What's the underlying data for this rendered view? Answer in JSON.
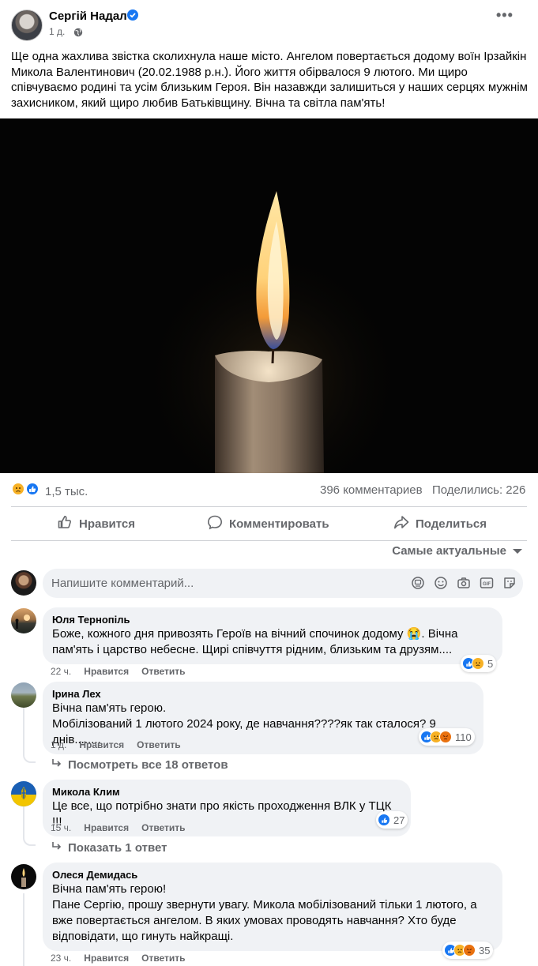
{
  "post": {
    "author": "Сергій Надал",
    "time": "1 д.",
    "more": "•••",
    "text": "Ще одна жахлива звістка сколихнула наше місто. Ангелом повертається додому воїн Ірзайкін Микола Валентинович (20.02.1988 р.н.). Його життя обірвалося 9 лютого. Ми щиро співчуваємо родині та усім близьким Героя. Він назавжди залишиться у наших серцях мужнім захисником, який щиро любив Батьківщину. Вічна та світла пам'ять!"
  },
  "stats": {
    "reactions": "1,5 тыс.",
    "comments": "396 комментариев",
    "shares": "Поделились: 226"
  },
  "actions": {
    "like": "Нравится",
    "comment": "Комментировать",
    "share": "Поделиться"
  },
  "sort": {
    "label": "Самые актуальные"
  },
  "composer": {
    "placeholder": "Напишите комментарий..."
  },
  "comments": [
    {
      "name": "Юля Тернопіль",
      "lines": [
        "Боже, кожного дня привозять Героїв на вічний спочинок додому 😭. Вічна",
        "пам'ять і царство небесне. Щирі співчуття рідним, близьким та друзям...."
      ],
      "time": "22 ч.",
      "like": "Нравится",
      "reply": "Ответить",
      "reactions": "5"
    },
    {
      "name": "Ірина Лех",
      "lines": [
        "Вічна пам'ять герою.",
        "Мобілізований 1 лютого 2024 року, де навчання????як так сталося? 9 днів........"
      ],
      "time": "1 д.",
      "like": "Нравится",
      "reply": "Ответить",
      "reactions": "110",
      "replies_link": "Посмотреть все 18 ответов"
    },
    {
      "name": "Микола Клим",
      "lines": [
        "Це все, що потрібно знати про якість проходження ВЛК у ТЦК !!!"
      ],
      "time": "15 ч.",
      "like": "Нравится",
      "reply": "Ответить",
      "reactions": "27",
      "replies_link": "Показать 1 ответ"
    },
    {
      "name": "Олеся Демидась",
      "lines": [
        "Вічна пам'ять герою!",
        "Пане Сергію, прошу звернути увагу. Микола мобілізований тільки 1 лютого, а",
        "вже повертається ангелом. В яких умовах проводять навчання? Хто буде",
        "відповідати, що гинуть найкращі."
      ],
      "time": "23 ч.",
      "like": "Нравится",
      "reply": "Ответить",
      "reactions": "35"
    }
  ],
  "colors": {
    "accent": "#1877f2",
    "secondary_text": "#65676b",
    "bubble": "#f0f2f5",
    "haha_sad": "#f7b125",
    "angry": "#e9710f"
  }
}
